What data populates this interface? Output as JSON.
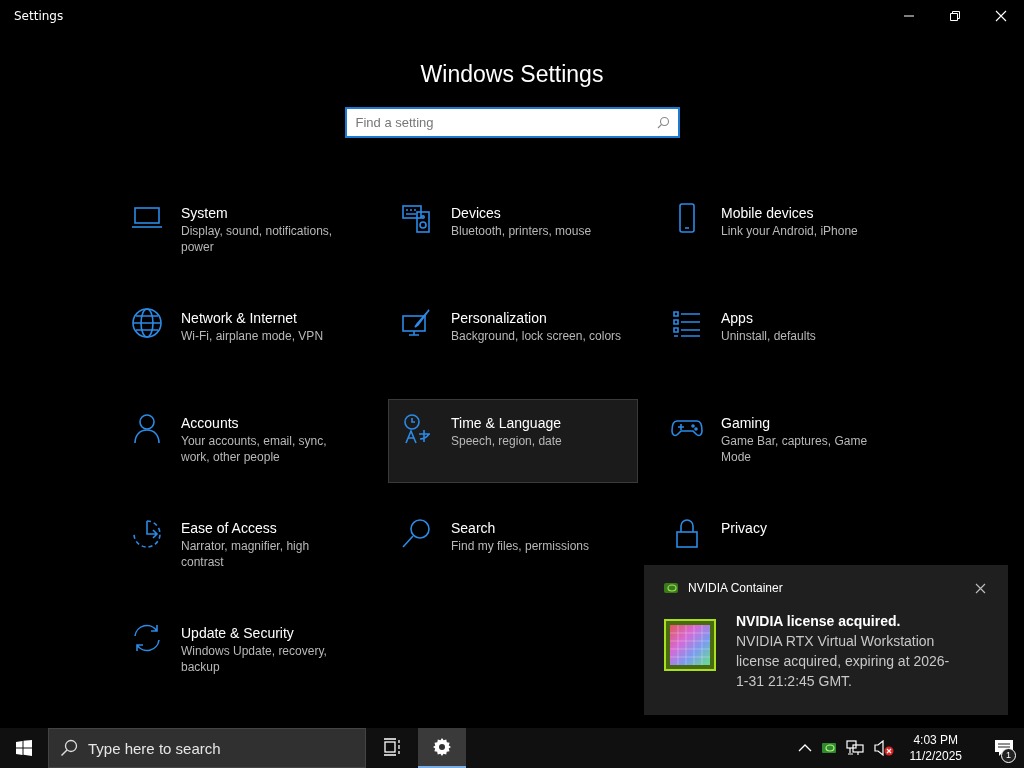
{
  "window": {
    "title": "Settings"
  },
  "heading": "Windows Settings",
  "search": {
    "placeholder": "Find a setting"
  },
  "tiles": [
    {
      "title": "System",
      "description": "Display, sound, notifications, power",
      "selected": false
    },
    {
      "title": "Devices",
      "description": "Bluetooth, printers, mouse",
      "selected": false
    },
    {
      "title": "Mobile devices",
      "description": "Link your Android, iPhone",
      "selected": false
    },
    {
      "title": "Network & Internet",
      "description": "Wi-Fi, airplane mode, VPN",
      "selected": false
    },
    {
      "title": "Personalization",
      "description": "Background, lock screen, colors",
      "selected": false
    },
    {
      "title": "Apps",
      "description": "Uninstall, defaults",
      "selected": false
    },
    {
      "title": "Accounts",
      "description": "Your accounts, email, sync, work, other people",
      "selected": false
    },
    {
      "title": "Time & Language",
      "description": "Speech, region, date",
      "selected": true
    },
    {
      "title": "Gaming",
      "description": "Game Bar, captures, Game Mode",
      "selected": false
    },
    {
      "title": "Ease of Access",
      "description": "Narrator, magnifier, high contrast",
      "selected": false
    },
    {
      "title": "Search",
      "description": "Find my files, permissions",
      "selected": false
    },
    {
      "title": "Privacy",
      "selected": false
    },
    {
      "title": "Update & Security",
      "description": "Windows Update, recovery, backup",
      "selected": false
    }
  ],
  "notification": {
    "app": "NVIDIA Container",
    "title": "NVIDIA license acquired.",
    "body": "NVIDIA RTX Virtual Workstation license acquired, expiring at 2026-1-31 21:2:45 GMT."
  },
  "taskbar": {
    "search_placeholder": "Type here to search",
    "apps": [
      {
        "kind": "taskview",
        "active": false
      },
      {
        "kind": "settings",
        "active": true
      }
    ],
    "time": "4:03 PM",
    "date": "11/2/2025",
    "notification_count": "1"
  }
}
